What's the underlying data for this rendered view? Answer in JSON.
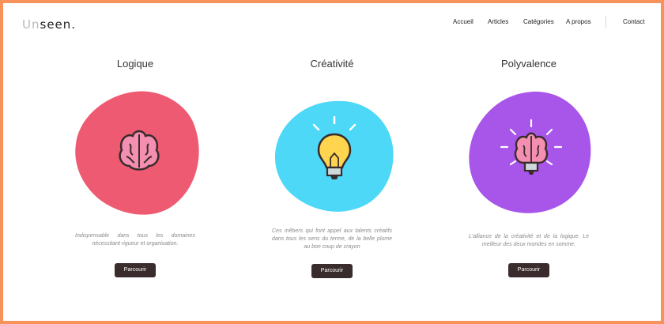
{
  "brand": {
    "logo_part1": "Un",
    "logo_part2": "seen."
  },
  "nav": {
    "items": [
      "Accueil",
      "Articles",
      "Catégories",
      "A propos"
    ],
    "contact": "Contact"
  },
  "cards": [
    {
      "title": "Logique",
      "description": "Indispensable dans tous les domaines nécessitant rigueur et organisation.",
      "button": "Parcourir",
      "blob_color": "#EE5A72",
      "icon": "brain-icon"
    },
    {
      "title": "Créativité",
      "description": "Ces mêbers qui font appel aux talents créatifs dans tous les sens du terme, de la belle plume au bon coup de crayon",
      "button": "Parcourir",
      "blob_color": "#4DD8F7",
      "icon": "lightbulb-icon"
    },
    {
      "title": "Polyvalence",
      "description": "L'alliance de la créativité et de la logique. Le meilleur des deux mondes en somme.",
      "button": "Parcourir",
      "blob_color": "#A855EA",
      "icon": "brain-lightbulb-icon"
    }
  ],
  "colors": {
    "page_border": "#F7925A",
    "button_bg": "#3A2C2C"
  }
}
